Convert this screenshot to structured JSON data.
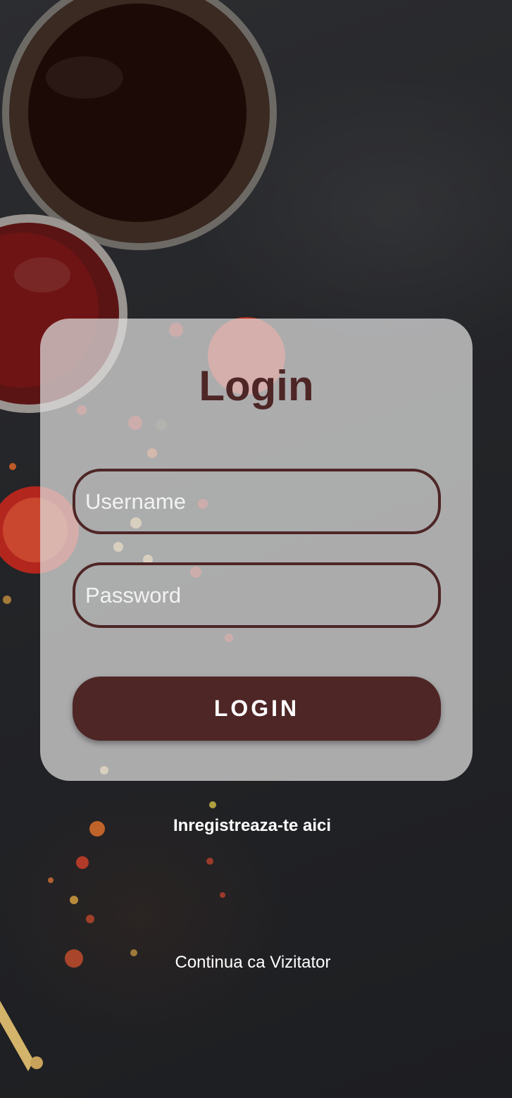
{
  "login": {
    "title": "Login",
    "username_placeholder": "Username",
    "password_placeholder": "Password",
    "login_button": "LOGIN",
    "register_link": "Inregistreaza-te aici",
    "guest_link": "Continua ca Vizitator"
  },
  "colors": {
    "accent": "#4e2626",
    "card": "#e1e1e1",
    "background": "#232427"
  }
}
